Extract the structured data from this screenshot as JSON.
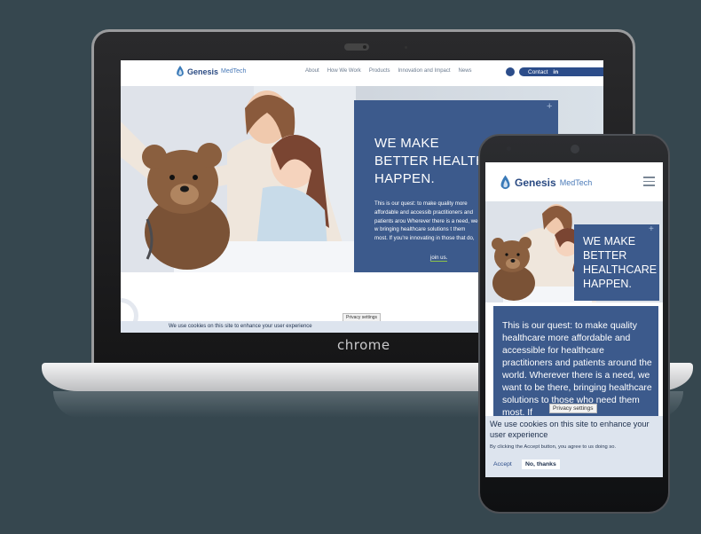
{
  "desktop": {
    "logo": {
      "brand": "Genesis",
      "sub": "MedTech"
    },
    "nav": [
      "About",
      "How We Work",
      "Products",
      "Innovation and Impact",
      "News"
    ],
    "contact_label": "Contact",
    "contact_social": "in",
    "headline_lines": [
      "WE MAKE",
      "BETTER HEALTH",
      "HAPPEN."
    ],
    "body_text": "This is our quest: to make quality more affordable and accessib practitioners and patients arou Wherever there is a need, we w bringing healthcare solutions t them most. If you're innovating in those that do,",
    "join_link": "join us.",
    "privacy_label": "Privacy settings",
    "cookie_text": "We use cookies on this site to enhance your user experience"
  },
  "laptop_brand": "chrome",
  "mobile": {
    "logo": {
      "brand": "Genesis",
      "sub": "MedTech"
    },
    "headline_lines": [
      "WE MAKE",
      "BETTER",
      "HEALTHCARE",
      "HAPPEN."
    ],
    "body_text": "This is our quest: to make quality healthcare more affordable and accessible for healthcare practitioners and patients around the world. Wherever there is a need, we want to be there, bringing healthcare solutions to those who need them most. If",
    "privacy_label": "Privacy settings",
    "cookie_title": "We use cookies on this site to enhance your user experience",
    "cookie_note": "By clicking the Accept button, you agree to us doing so.",
    "accept_label": "Accept",
    "no_thanks_label": "No, thanks"
  },
  "colors": {
    "background": "#36474f",
    "brand_blue": "#3c5a8c",
    "nav_blue": "#2c4d8a",
    "cookie_bar": "#dde4ee",
    "accent_green": "#8bc34a"
  }
}
